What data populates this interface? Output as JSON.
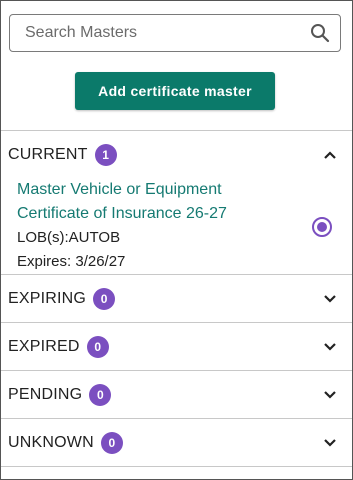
{
  "search": {
    "placeholder": "Search Masters",
    "icon": "search-icon"
  },
  "add_button": {
    "label": "Add certificate master",
    "color": "#0b7a6a"
  },
  "badge_color": "#7b4fc0",
  "sections": [
    {
      "title": "CURRENT",
      "count": "1",
      "expanded": true,
      "items": [
        {
          "title_line1": "Master Vehicle or Equipment",
          "title_line2": "Certificate of Insurance 26-27",
          "lob": "LOB(s):AUTOB",
          "expires": "Expires: 3/26/27",
          "selected": true
        }
      ]
    },
    {
      "title": "EXPIRING",
      "count": "0",
      "expanded": false
    },
    {
      "title": "EXPIRED",
      "count": "0",
      "expanded": false
    },
    {
      "title": "PENDING",
      "count": "0",
      "expanded": false
    },
    {
      "title": "UNKNOWN",
      "count": "0",
      "expanded": false
    }
  ]
}
